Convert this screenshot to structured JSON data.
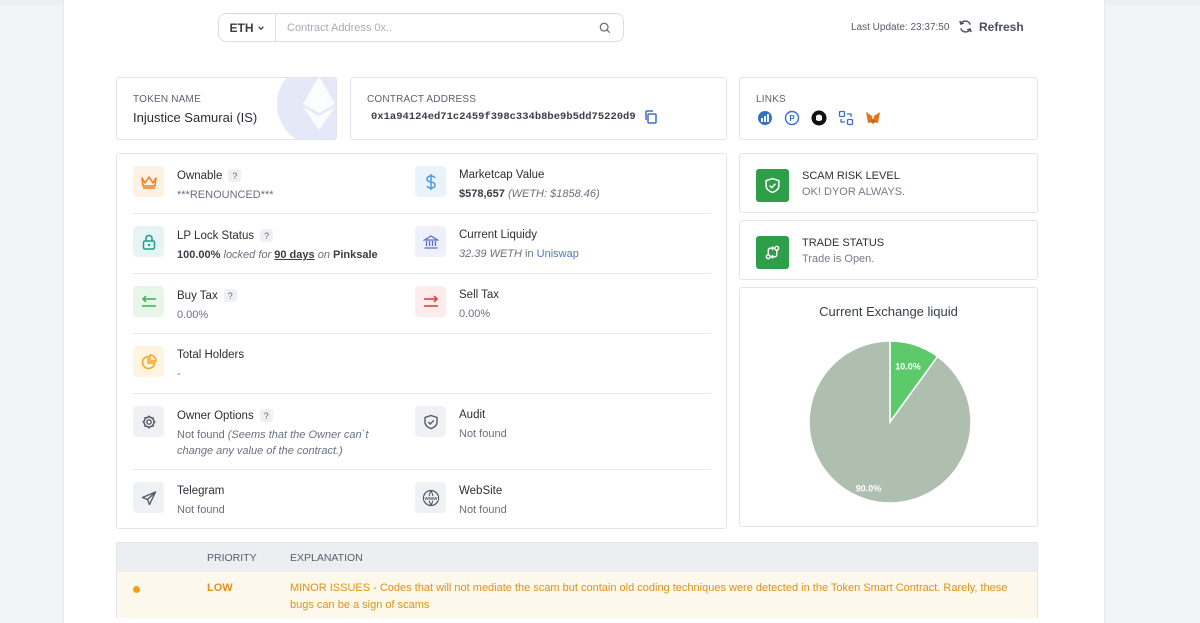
{
  "search": {
    "chain": "ETH",
    "placeholder": "Contract Address 0x..",
    "value": ""
  },
  "header": {
    "last_update": "Last Update: 23:37:50",
    "refresh_label": "Refresh"
  },
  "token": {
    "caption": "TOKEN NAME",
    "name": "Injustice Samurai (IS)"
  },
  "contract": {
    "caption": "CONTRACT ADDRESS",
    "address": "0x1a94124ed71c2459f398c334b8be9b5dd75220d9"
  },
  "links": {
    "caption": "LINKS",
    "icons": [
      "coingecko-icon",
      "poocoin-icon",
      "github-icon",
      "swap-icon",
      "metamask-icon"
    ]
  },
  "ownable": {
    "title": "Ownable",
    "badge": "?",
    "value": "***RENOUNCED***"
  },
  "marketcap": {
    "title": "Marketcap Value",
    "value": "$578,657",
    "value_note": "(WETH: $1858.46)"
  },
  "lp_lock": {
    "title": "LP Lock Status",
    "badge": "?",
    "percent": "100.00%",
    "locked_for": "locked for",
    "days": "90 days",
    "on": "on",
    "platform": "Pinksale"
  },
  "liquidity": {
    "title": "Current Liquidy",
    "amount": "32.39 WETH",
    "in": "in",
    "dex": "Uniswap"
  },
  "buy_tax": {
    "title": "Buy Tax",
    "badge": "?",
    "value": "0.00%"
  },
  "sell_tax": {
    "title": "Sell Tax",
    "value": "0.00%"
  },
  "holders": {
    "title": "Total Holders",
    "value": "-"
  },
  "owner_options": {
    "title": "Owner Options",
    "badge": "?",
    "value": "Not found",
    "note": "(Seems that the Owner can`t change any value of the contract.)"
  },
  "audit": {
    "title": "Audit",
    "value": "Not found"
  },
  "telegram": {
    "title": "Telegram",
    "value": "Not found"
  },
  "website": {
    "title": "WebSite",
    "value": "Not found"
  },
  "scam_risk": {
    "title": "SCAM RISK LEVEL",
    "value": "OK! DYOR ALWAYS."
  },
  "trade_status": {
    "title": "TRADE STATUS",
    "value": "Trade is Open."
  },
  "chart_data": {
    "type": "pie",
    "title": "Current Exchange liquid",
    "slices": [
      {
        "label": "10.0%",
        "value": 10.0,
        "color": "#5cc96a"
      },
      {
        "label": "90.0%",
        "value": 90.0,
        "color": "#aebfb0"
      }
    ]
  },
  "issues": {
    "headers": {
      "priority": "PRIORITY",
      "explanation": "EXPLANATION"
    },
    "rows": [
      {
        "priority": "LOW",
        "explanation": "MINOR ISSUES - Codes that will not mediate the scam but contain old coding techniques were detected in the Token Smart Contract. Rarely, these bugs can be a sign of scams"
      }
    ]
  }
}
